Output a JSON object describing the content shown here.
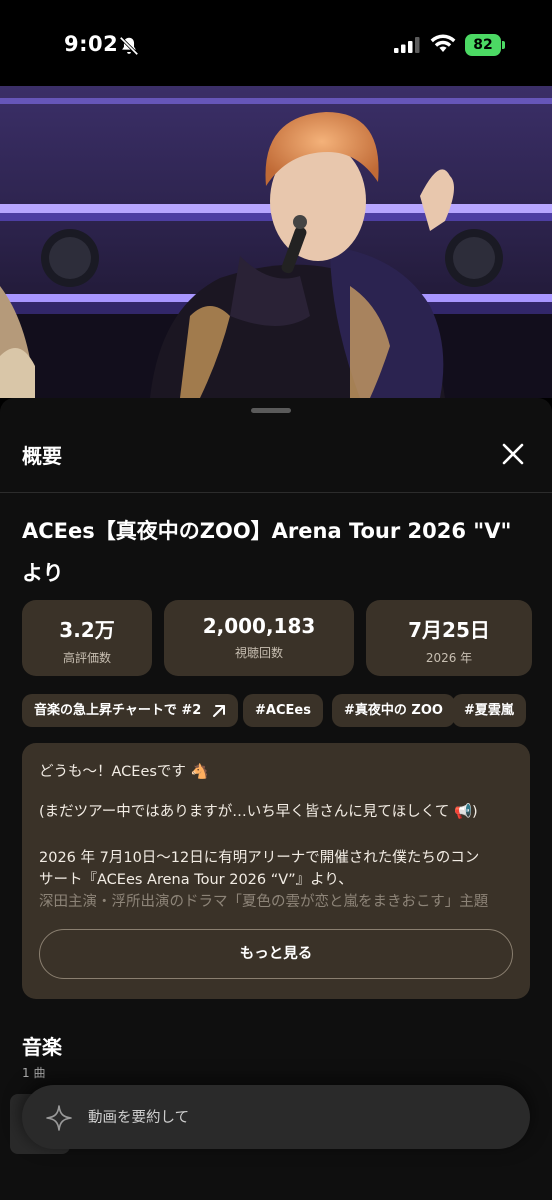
{
  "status": {
    "time": "9:02",
    "battery": "82",
    "icons": [
      "bell-slash-icon",
      "signal-icon",
      "wifi-icon",
      "battery-icon"
    ]
  },
  "sheet": {
    "title": "概要",
    "close_icon": "close-icon"
  },
  "video": {
    "title_line1": "ACEes【真夜中のZOO】Arena Tour 2026 \"V\"",
    "title_line2": "より"
  },
  "stats": [
    {
      "value": "3.2万",
      "label": "高評価数"
    },
    {
      "value": "2,000,183",
      "label": "視聴回数"
    },
    {
      "value": "7月25日",
      "label": "2026 年"
    }
  ],
  "chips": [
    {
      "label": "音楽の急上昇チャートで #2",
      "icon": "arrow-up-right-icon"
    },
    {
      "label": "#ACEes"
    },
    {
      "label": "#真夜中の ZOO"
    },
    {
      "label": "#夏雲嵐"
    }
  ],
  "description": {
    "lines": [
      "どうも〜！ACEesです 🐴",
      "",
      "(まだツアー中ではありますが…いち早く皆さんに見てほしくて 📢)",
      "",
      "2026 年 7月10日〜12日に有明アリーナで開催された僕たちのコン",
      "サート『ACEes Arena Tour 2026 “V”』より、",
      "深田主演・浮所出演のドラマ「夏色の雲が恋と嵐をまきおこす」主題"
    ],
    "more_label": "もっと見る"
  },
  "music": {
    "heading": "音楽",
    "count": "1 曲"
  },
  "summarize": {
    "label": "動画を要約して",
    "icon": "sparkle-icon"
  }
}
